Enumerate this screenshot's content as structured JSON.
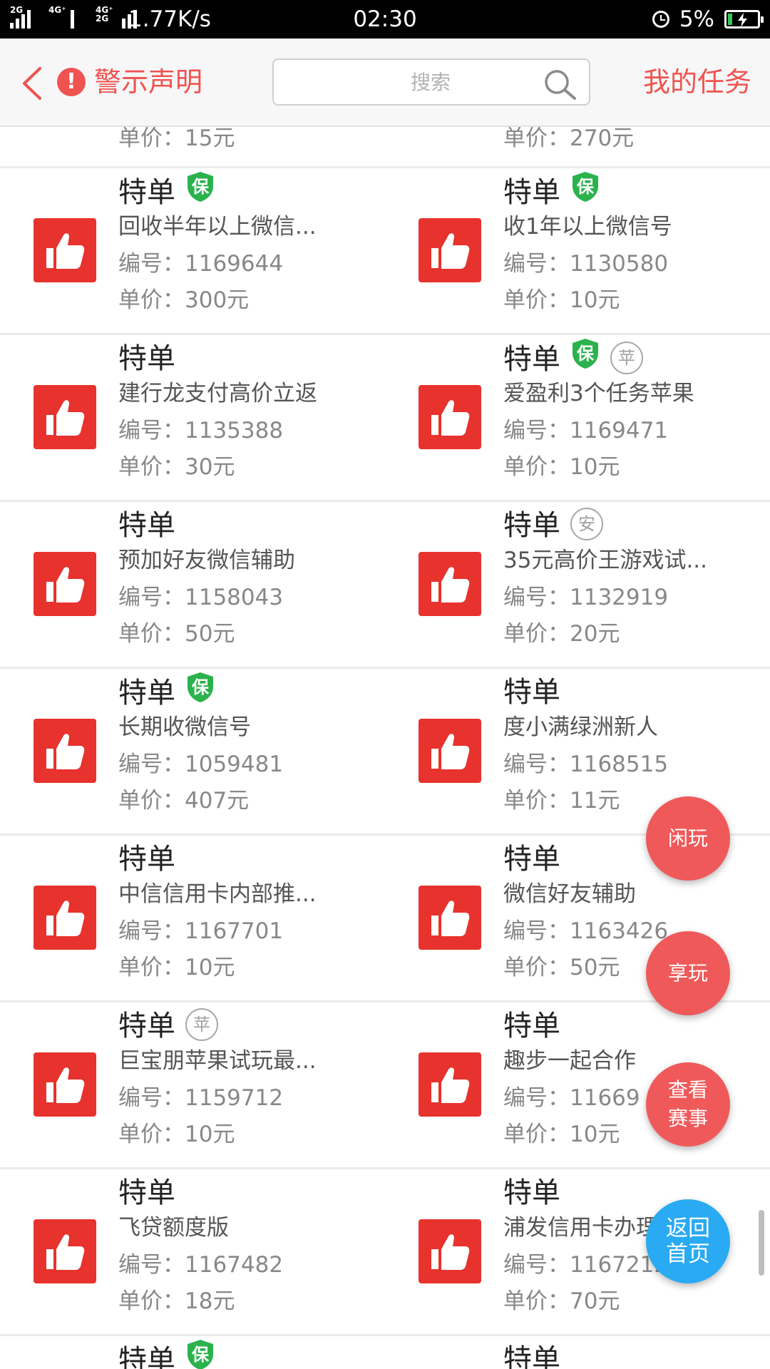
{
  "status_bar": {
    "net_tag_1": "2G",
    "net_tag_2": "4G⁺",
    "net_tag_3": "4G⁺ 2G",
    "speed": "1.77K/s",
    "time": "02:30",
    "battery": "5%"
  },
  "header": {
    "warning": "警示声明",
    "search_placeholder": "搜索",
    "my_tasks": "我的任务"
  },
  "top_partial": {
    "left_price": "单价：15元",
    "right_price": "单价：270元"
  },
  "rows": [
    {
      "left": {
        "title": "特单",
        "badge": "保",
        "name": "回收半年以上微信...",
        "code": "编号：1169644",
        "price": "单价：300元"
      },
      "right": {
        "title": "特单",
        "badge": "保",
        "name": "收1年以上微信号",
        "code": "编号：1130580",
        "price": "单价：10元"
      }
    },
    {
      "left": {
        "title": "特单",
        "name": "建行龙支付高价立返",
        "code": "编号：1135388",
        "price": "单价：30元"
      },
      "right": {
        "title": "特单",
        "badge": "保",
        "platform": "苹",
        "name": "爱盈利3个任务苹果",
        "code": "编号：1169471",
        "price": "单价：10元"
      }
    },
    {
      "left": {
        "title": "特单",
        "name": "预加好友微信辅助",
        "code": "编号：1158043",
        "price": "单价：50元"
      },
      "right": {
        "title": "特单",
        "platform": "安",
        "name": "35元高价王游戏试...",
        "code": "编号：1132919",
        "price": "单价：20元"
      }
    },
    {
      "left": {
        "title": "特单",
        "badge": "保",
        "name": "长期收微信号",
        "code": "编号：1059481",
        "price": "单价：407元"
      },
      "right": {
        "title": "特单",
        "name": "度小满绿洲新人",
        "code": "编号：1168515",
        "price": "单价：11元"
      }
    },
    {
      "left": {
        "title": "特单",
        "name": "中信信用卡内部推...",
        "code": "编号：1167701",
        "price": "单价：10元"
      },
      "right": {
        "title": "特单",
        "name": "微信好友辅助",
        "code": "编号：1163426",
        "price": "单价：50元"
      }
    },
    {
      "left": {
        "title": "特单",
        "platform": "苹",
        "name": "巨宝朋苹果试玩最...",
        "code": "编号：1159712",
        "price": "单价：10元"
      },
      "right": {
        "title": "特单",
        "name": "趣步一起合作",
        "code": "编号：11669",
        "price": "单价：10元"
      }
    },
    {
      "left": {
        "title": "特单",
        "name": "飞贷额度版",
        "code": "编号：1167482",
        "price": "单价：18元"
      },
      "right": {
        "title": "特单",
        "name": "浦发信用卡办理",
        "code": "编号：1167212",
        "price": "单价：70元"
      }
    }
  ],
  "bottom_partial": {
    "left_title": "特单",
    "left_badge": "保",
    "right_title": "特单"
  },
  "fabs": {
    "xianwan": "闲玩",
    "xiangwan": "享玩",
    "view_events": "查看\n赛事",
    "back_home": "返回\n首页"
  },
  "colors": {
    "accent": "#ef5350",
    "thumb_red": "#e7322d",
    "badge_green": "#2bb24c",
    "fab_red": "#f0595a",
    "fab_blue": "#29aaf2"
  }
}
